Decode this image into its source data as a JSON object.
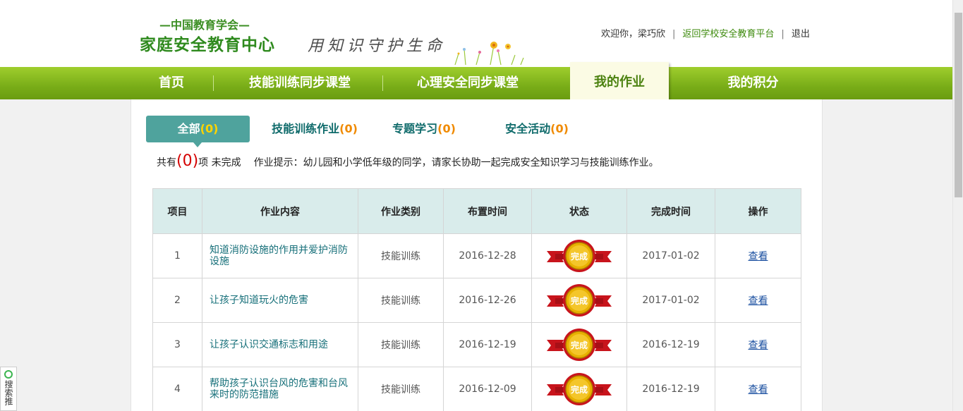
{
  "header": {
    "org_line": "—中国教育学会—",
    "center_name": "家庭安全教育中心",
    "slogan": "用知识守护生命",
    "greeting": "欢迎你，梁巧欣",
    "return_link": "返回学校安全教育平台",
    "logout": "退出"
  },
  "nav": {
    "items": [
      "首页",
      "技能训练同步课堂",
      "心理安全同步课堂",
      "我的作业",
      "我的积分"
    ],
    "active": "我的作业"
  },
  "tabs": [
    {
      "label": "全部",
      "count": "(0)"
    },
    {
      "label": "技能训练作业",
      "count": "(0)"
    },
    {
      "label": "专题学习",
      "count": "(0)"
    },
    {
      "label": "安全活动",
      "count": "(0)"
    }
  ],
  "summary": {
    "prefix": "共有",
    "count": "(0)",
    "suffix": "项 未完成",
    "hint": "作业提示：幼儿园和小学低年级的同学，请家长协助一起完成安全知识学习与技能训练作业。"
  },
  "table": {
    "headers": [
      "项目",
      "作业内容",
      "作业类别",
      "布置时间",
      "状态",
      "完成时间",
      "操作"
    ],
    "rows": [
      {
        "no": "1",
        "content": "知道消防设施的作用并爱护消防设施",
        "category": "技能训练",
        "assigned": "2016-12-28",
        "status": "完成",
        "completed": "2017-01-02",
        "action": "查看"
      },
      {
        "no": "2",
        "content": "让孩子知道玩火的危害",
        "category": "技能训练",
        "assigned": "2016-12-26",
        "status": "完成",
        "completed": "2017-01-02",
        "action": "查看"
      },
      {
        "no": "3",
        "content": "让孩子认识交通标志和用途",
        "category": "技能训练",
        "assigned": "2016-12-19",
        "status": "完成",
        "completed": "2016-12-19",
        "action": "查看"
      },
      {
        "no": "4",
        "content": "帮助孩子认识台风的危害和台风来时的防范措施",
        "category": "技能训练",
        "assigned": "2016-12-09",
        "status": "完成",
        "completed": "2016-12-19",
        "action": "查看"
      }
    ]
  },
  "side_widget": {
    "label": "搜索推"
  },
  "colors": {
    "nav_green": "#79ad18",
    "tab_teal": "#4fa39d",
    "badge_red": "#c8141c",
    "badge_gold": "#e6a400"
  }
}
